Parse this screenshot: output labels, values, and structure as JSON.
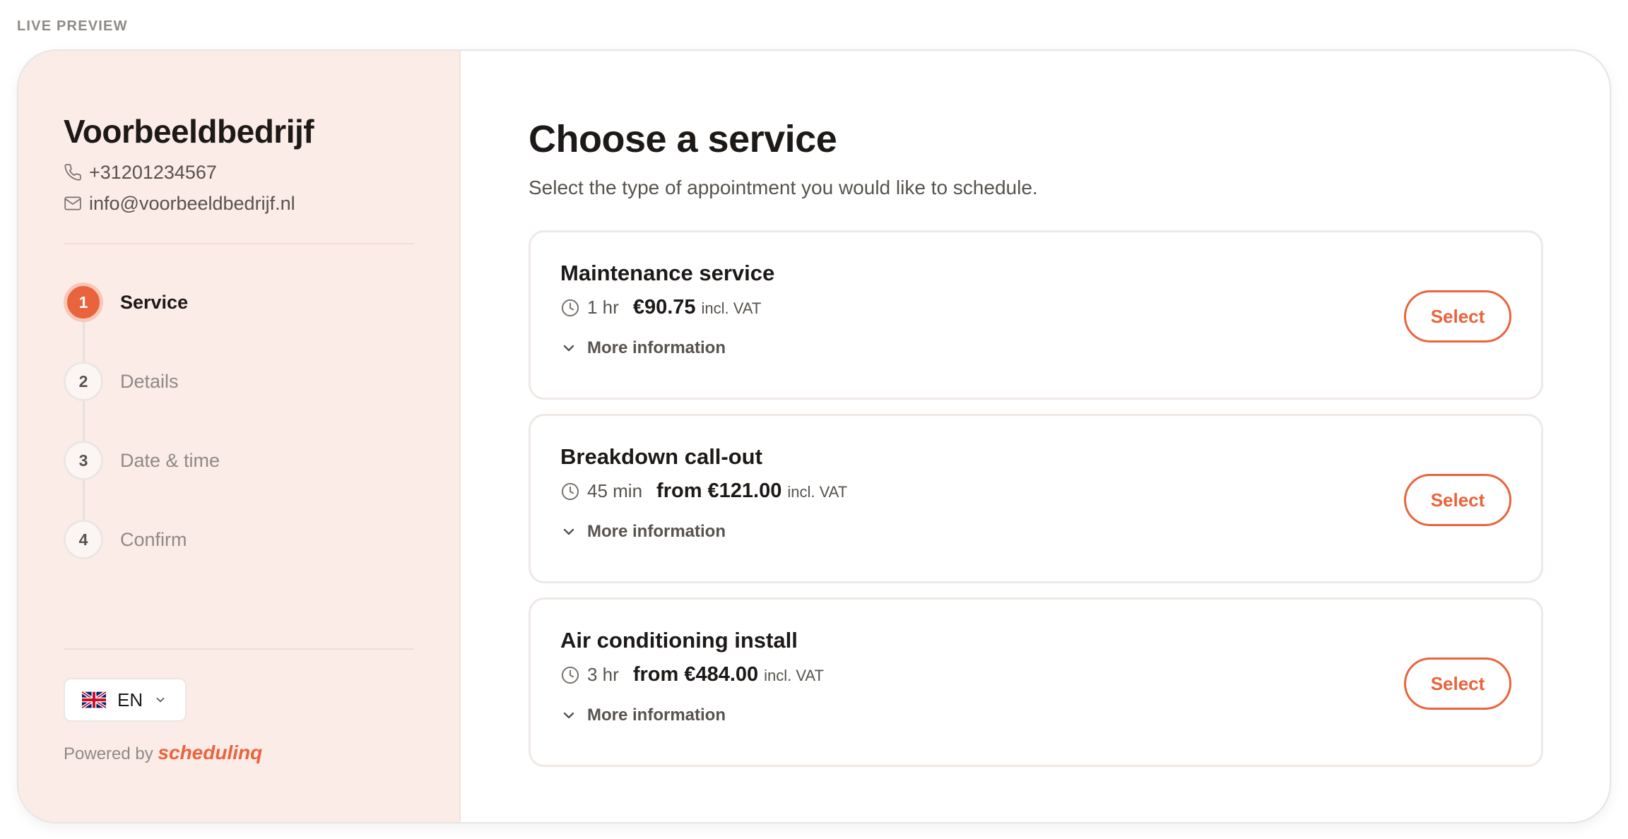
{
  "preview_label": "LIVE PREVIEW",
  "company": {
    "name": "Voorbeeldbedrijf",
    "phone": "+31201234567",
    "email": "info@voorbeeldbedrijf.nl"
  },
  "steps": [
    {
      "number": "1",
      "label": "Service",
      "active": true
    },
    {
      "number": "2",
      "label": "Details",
      "active": false
    },
    {
      "number": "3",
      "label": "Date & time",
      "active": false
    },
    {
      "number": "4",
      "label": "Confirm",
      "active": false
    }
  ],
  "language": {
    "code": "EN",
    "flag": "uk-flag-icon"
  },
  "footer": {
    "powered_by": "Powered by",
    "brand": "schedulinq"
  },
  "main": {
    "title": "Choose a service",
    "subtitle": "Select the type of appointment you would like to schedule."
  },
  "services": [
    {
      "name": "Maintenance service",
      "duration": "1 hr",
      "price": "€90.75",
      "vat": "incl. VAT",
      "more": "More information",
      "select": "Select"
    },
    {
      "name": "Breakdown call-out",
      "duration": "45 min",
      "price": "from €121.00",
      "vat": "incl. VAT",
      "more": "More information",
      "select": "Select"
    },
    {
      "name": "Air conditioning install",
      "duration": "3 hr",
      "price": "from €484.00",
      "vat": "incl. VAT",
      "more": "More information",
      "select": "Select"
    }
  ],
  "colors": {
    "accent": "#e9643c",
    "sidebar_bg": "#fcece8",
    "text_primary": "#1c1917",
    "text_muted": "#57534e"
  }
}
